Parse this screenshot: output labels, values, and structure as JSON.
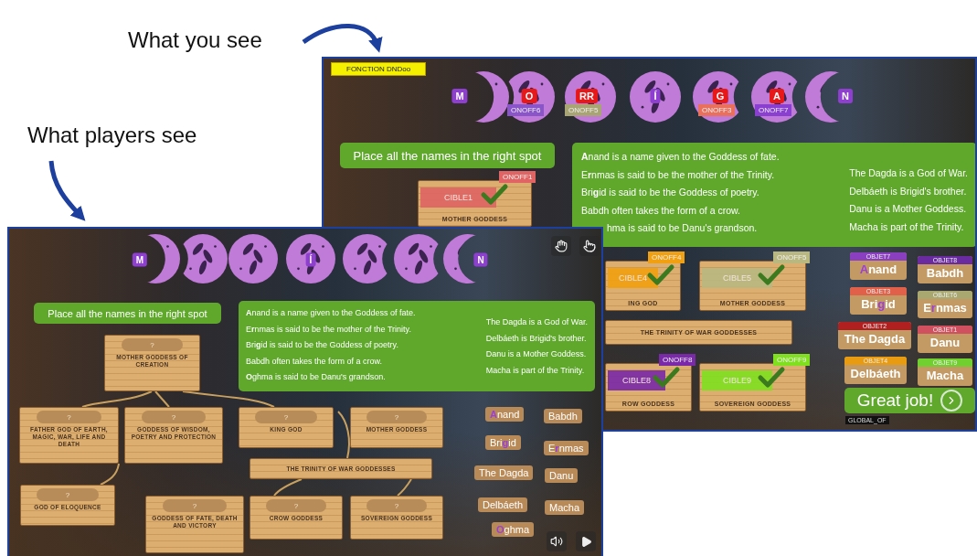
{
  "designer_view": {
    "caption": "What you see",
    "function_label": "FONCTION DNDoo",
    "moons": [
      {
        "kind": "crescent",
        "mirrored": false,
        "badge": {
          "text": "M",
          "color": "#8e3fd0"
        }
      },
      {
        "kind": "gibbous",
        "mirrored": false,
        "badge": {
          "text": "O",
          "color": "#e81818"
        },
        "toggle": {
          "text": "ONOFF6",
          "color": "#8a55c8"
        }
      },
      {
        "kind": "full",
        "badge": {
          "text": "RR",
          "color": "#e81818"
        },
        "toggle": {
          "text": "ONOFF5",
          "color": "#a8a474"
        }
      },
      {
        "kind": "full",
        "badge": {
          "text": "Í",
          "color": "#8e3fd0"
        }
      },
      {
        "kind": "gibbous",
        "mirrored": true,
        "badge": {
          "text": "G",
          "color": "#e81818"
        },
        "toggle": {
          "text": "ONOFF3",
          "color": "#e8705c"
        }
      },
      {
        "kind": "gibbous",
        "mirrored": true,
        "badge": {
          "text": "A",
          "color": "#e81818"
        },
        "toggle": {
          "text": "ONOFF7",
          "color": "#8a3fd0"
        }
      },
      {
        "kind": "crescent",
        "mirrored": true,
        "badge": {
          "text": "N",
          "color": "#8e3fd0"
        }
      }
    ],
    "instruction": "Place all the names in the right spot",
    "clues": {
      "left": [
        "**A**nand is a name given to the Goddess of fate.",
        "E**r**nmas is said to be the mother of the Trinity.",
        "Bri**g**id is said to be the Goddess of poetry.",
        "Babdh often takes the form of a crow.",
        "hma is said to be Danu's grandson."
      ],
      "right": [
        "The Dagda is a God of War.",
        "Delbáeth is Brigid's brother.",
        "Danu is a Mother Goddess.",
        "Macha is part of the Trinity."
      ]
    },
    "targets": [
      {
        "zone": "CIBLE1",
        "color": "#e06464",
        "toggle": "ONOFF1",
        "label": "MOTHER GODDESS",
        "checked": true
      },
      {
        "zone": "CIBLE4",
        "color": "#f0a010",
        "toggle": "ONOFF4",
        "label": "ING GOD",
        "checked": true
      },
      {
        "zone": "CIBLE5",
        "color": "#b8b880",
        "toggle": "ONOFF5",
        "label": "MOTHER GODDESS",
        "checked": true
      },
      {
        "zone": "CIBLE8",
        "color": "#7a2aa8",
        "toggle": "ONOFF8",
        "label": "ROW GODDESS",
        "checked": true
      },
      {
        "zone": "CIBLE9",
        "color": "#80e020",
        "toggle": "ONOFF9",
        "label": "SOVEREIGN GODDESS",
        "checked": true
      }
    ],
    "trinity_label": "THE TRINITY OF WAR GODDESSES",
    "objects": [
      {
        "tag": "OBJET7",
        "color": "#8a3fc0",
        "name": "**A**nand"
      },
      {
        "tag": "OBJET8",
        "color": "#6a2aa0",
        "name": "Babdh"
      },
      {
        "tag": "OBJET3",
        "color": "#e0604a",
        "name": "Bri**g**id"
      },
      {
        "tag": "OBJET6",
        "color": "#a8a870",
        "name": "E**r**nmas"
      },
      {
        "tag": "OBJET2",
        "color": "#b02020",
        "name": "The Dagda"
      },
      {
        "tag": "OBJET1",
        "color": "#d05060",
        "name": "Danu"
      },
      {
        "tag": "OBJET4",
        "color": "#e89a10",
        "name": "Delbáeth"
      },
      {
        "tag": "OBJET9",
        "color": "#70d030",
        "name": "Macha"
      }
    ],
    "feedback": "Great job!",
    "global_label": "GLOBAL_OF"
  },
  "player_view": {
    "caption": "What players see",
    "moons": [
      {
        "kind": "crescent",
        "mirrored": false,
        "badge": {
          "text": "M",
          "color": "#8e3fd0"
        }
      },
      {
        "kind": "gibbous",
        "mirrored": false
      },
      {
        "kind": "full"
      },
      {
        "kind": "full",
        "badge": {
          "text": "Í",
          "color": "#8e3fd0"
        }
      },
      {
        "kind": "gibbous",
        "mirrored": true
      },
      {
        "kind": "gibbous",
        "mirrored": true
      },
      {
        "kind": "crescent",
        "mirrored": true,
        "badge": {
          "text": "N",
          "color": "#8e3fd0"
        }
      }
    ],
    "instruction": "Place all the names in the right spot",
    "clues": {
      "left": [
        "**A**nand is a name given to the Goddess of fate.",
        "E**r**nmas is said to be the mother of the Trinity.",
        "Bri**g**id is said to be the Goddess of poetry.",
        "Babdh often takes the form of a crow.",
        "**O**ghma is said to be Danu's grandson."
      ],
      "right": [
        "The Dagda is a God of War.",
        "Delbáeth is Brigid's brother.",
        "Danu is a Mother Goddess.",
        "Macha is part of the Trinity."
      ]
    },
    "signs": [
      {
        "slot": "?",
        "label": "MOTHER GODDESS OF CREATION"
      },
      {
        "slot": "?",
        "label": "FATHER GOD OF EARTH, MAGIC, WAR, LIFE AND DEATH"
      },
      {
        "slot": "?",
        "label": "GODDESS OF WISDOM, POETRY AND PROTECTION"
      },
      {
        "slot": "?",
        "label": "KING GOD"
      },
      {
        "slot": "?",
        "label": "MOTHER GODDESS"
      },
      {
        "label": "THE TRINITY OF WAR GODDESSES"
      },
      {
        "slot": "?",
        "label": "GOD OF ELOQUENCE"
      },
      {
        "slot": "?",
        "label": "GODDESS OF FATE, DEATH AND VICTORY"
      },
      {
        "slot": "?",
        "label": "CROW GODDESS"
      },
      {
        "slot": "?",
        "label": "SOVEREIGN GODDESS"
      }
    ],
    "names": [
      "**A**nand",
      "Babdh",
      "Bri**g**id",
      "E**r**nmas",
      "The Dagda",
      "Danu",
      "Delbáeth",
      "Macha",
      "**O**ghma"
    ]
  }
}
